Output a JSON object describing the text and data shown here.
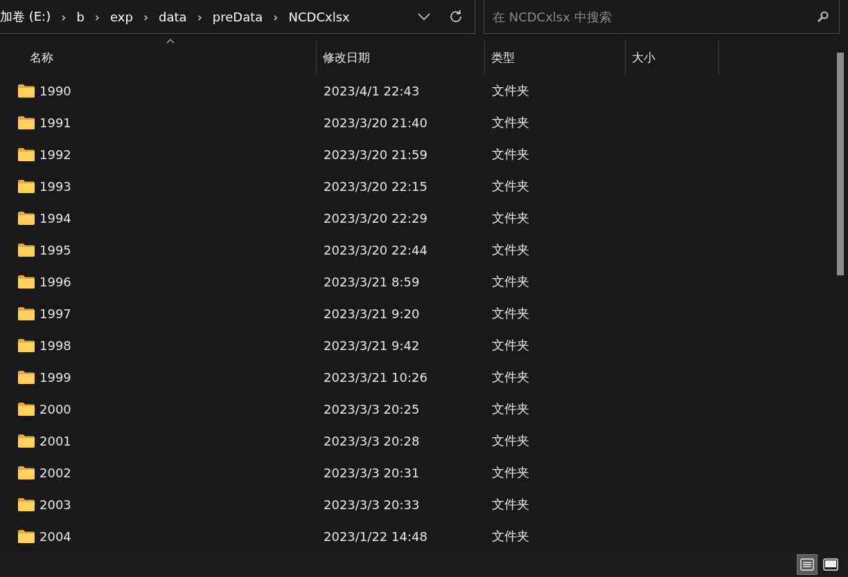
{
  "address_bar": {
    "crumbs": [
      "加卷 (E:)",
      "b",
      "exp",
      "data",
      "preData",
      "NCDCxlsx"
    ],
    "separator": "›"
  },
  "search": {
    "placeholder": "在 NCDCxlsx 中搜索"
  },
  "table": {
    "columns": [
      {
        "label": "名称",
        "sorted": true
      },
      {
        "label": "修改日期",
        "sorted": false
      },
      {
        "label": "类型",
        "sorted": false
      },
      {
        "label": "大小",
        "sorted": false
      }
    ],
    "rows": [
      {
        "name": "1990",
        "modified": "2023/4/1 22:43",
        "type": "文件夹"
      },
      {
        "name": "1991",
        "modified": "2023/3/20 21:40",
        "type": "文件夹"
      },
      {
        "name": "1992",
        "modified": "2023/3/20 21:59",
        "type": "文件夹"
      },
      {
        "name": "1993",
        "modified": "2023/3/20 22:15",
        "type": "文件夹"
      },
      {
        "name": "1994",
        "modified": "2023/3/20 22:29",
        "type": "文件夹"
      },
      {
        "name": "1995",
        "modified": "2023/3/20 22:44",
        "type": "文件夹"
      },
      {
        "name": "1996",
        "modified": "2023/3/21 8:59",
        "type": "文件夹"
      },
      {
        "name": "1997",
        "modified": "2023/3/21 9:20",
        "type": "文件夹"
      },
      {
        "name": "1998",
        "modified": "2023/3/21 9:42",
        "type": "文件夹"
      },
      {
        "name": "1999",
        "modified": "2023/3/21 10:26",
        "type": "文件夹"
      },
      {
        "name": "2000",
        "modified": "2023/3/3 20:25",
        "type": "文件夹"
      },
      {
        "name": "2001",
        "modified": "2023/3/3 20:28",
        "type": "文件夹"
      },
      {
        "name": "2002",
        "modified": "2023/3/3 20:31",
        "type": "文件夹"
      },
      {
        "name": "2003",
        "modified": "2023/3/3 20:33",
        "type": "文件夹"
      },
      {
        "name": "2004",
        "modified": "2023/1/22 14:48",
        "type": "文件夹"
      }
    ]
  },
  "view_buttons": [
    {
      "kind": "details",
      "selected": true
    },
    {
      "kind": "tiles",
      "selected": false
    }
  ]
}
